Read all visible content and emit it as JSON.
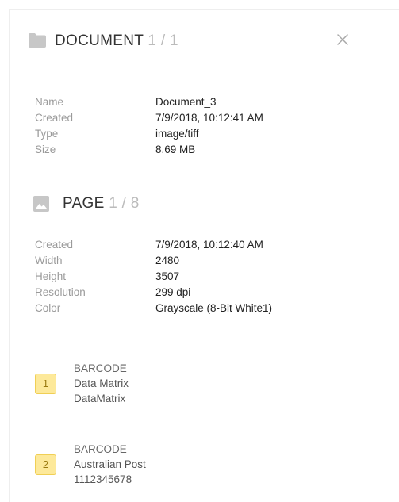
{
  "document": {
    "title": "DOCUMENT",
    "counter": "1 / 1",
    "properties": [
      {
        "label": "Name",
        "value": "Document_3"
      },
      {
        "label": "Created",
        "value": "7/9/2018, 10:12:41 AM"
      },
      {
        "label": "Type",
        "value": "image/tiff"
      },
      {
        "label": "Size",
        "value": "8.69 MB"
      }
    ]
  },
  "page": {
    "title": "PAGE",
    "counter": "1 / 8",
    "properties": [
      {
        "label": "Created",
        "value": "7/9/2018, 10:12:40 AM"
      },
      {
        "label": "Width",
        "value": "2480"
      },
      {
        "label": "Height",
        "value": "3507"
      },
      {
        "label": "Resolution",
        "value": "299 dpi"
      },
      {
        "label": "Color",
        "value": "Grayscale  (8-Bit White1)"
      }
    ]
  },
  "results": [
    {
      "index": "1",
      "kind": "BARCODE",
      "symbology": "Data Matrix",
      "value": "DataMatrix"
    },
    {
      "index": "2",
      "kind": "BARCODE",
      "symbology": "Australian Post",
      "value": "1112345678"
    }
  ],
  "icons": {
    "folder": "folder-icon",
    "close": "close-icon",
    "image": "image-icon"
  },
  "colors": {
    "badge_fill": "#fde99a",
    "badge_border": "#f0cf55",
    "label_gray": "#9a9a9a",
    "counter_gray": "#bbbbbb"
  }
}
